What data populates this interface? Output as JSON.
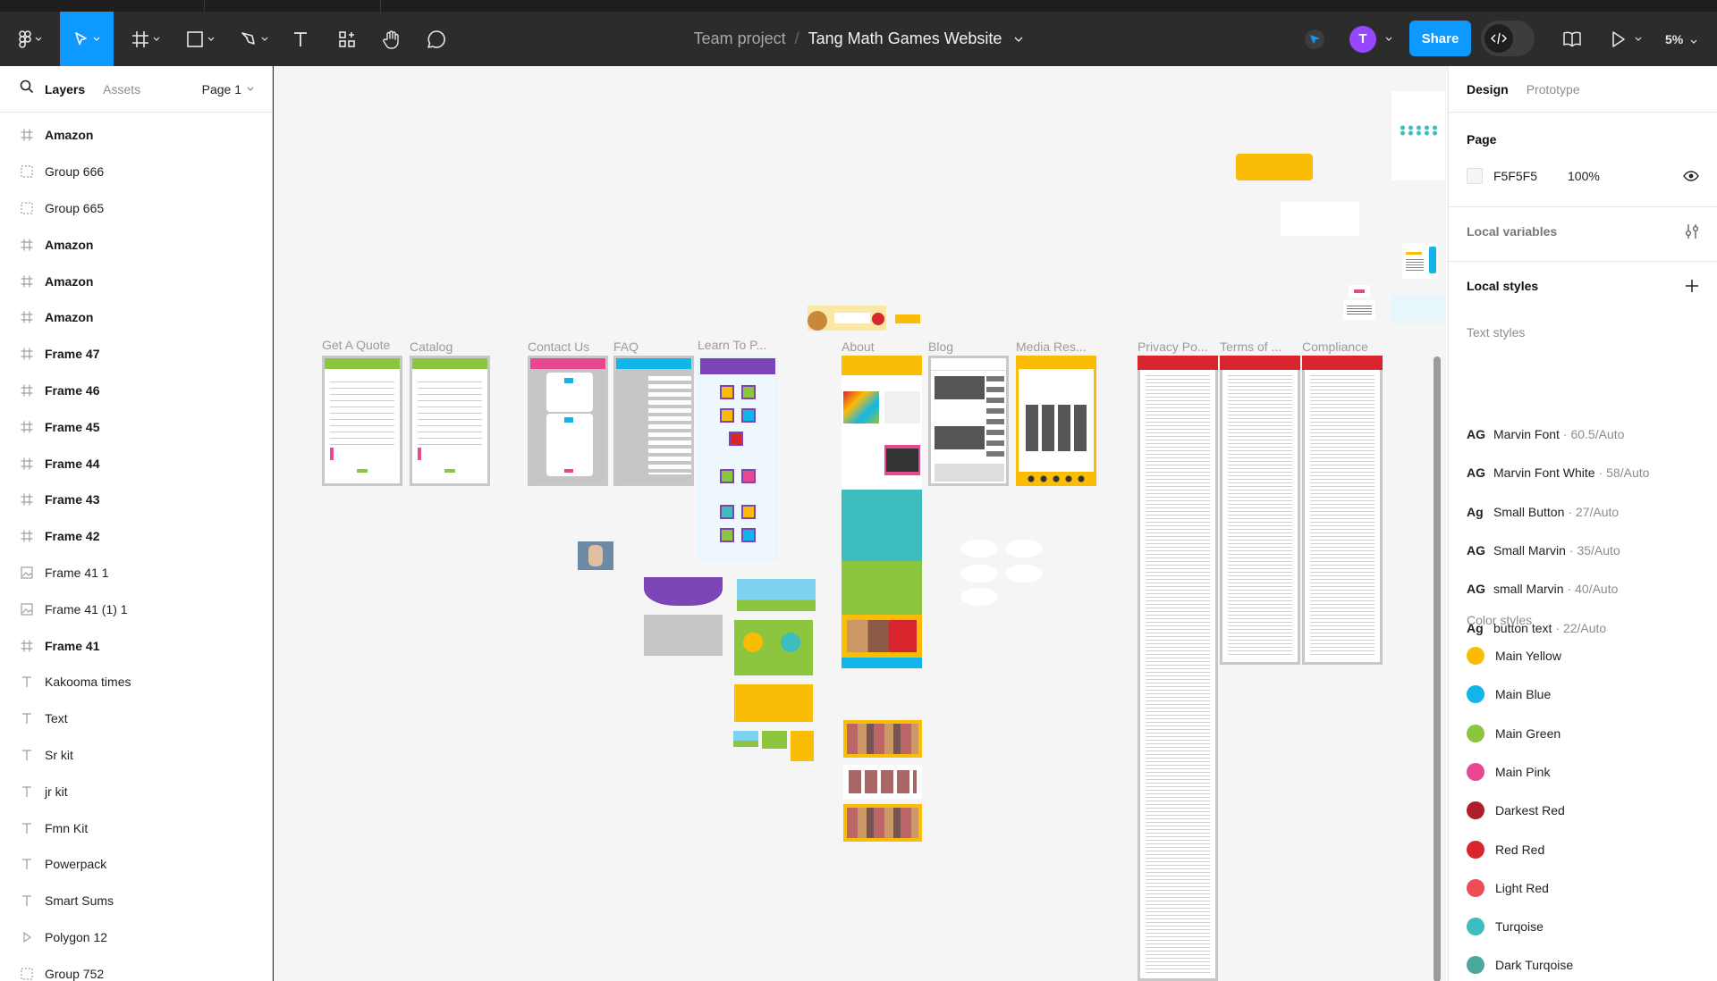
{
  "toolbar": {
    "breadcrumb_team": "Team project",
    "breadcrumb_sep": "/",
    "file_name": "Tang Math Games Website",
    "avatar_initial": "T",
    "share_label": "Share",
    "zoom": "5%",
    "colors": {
      "bar": "#2c2c2c",
      "accent": "#0d99ff",
      "avatar": "#9747ff"
    }
  },
  "left_panel": {
    "tab_layers": "Layers",
    "tab_assets": "Assets",
    "page": "Page 1",
    "layers": [
      {
        "name": "Amazon",
        "kind": "frame"
      },
      {
        "name": "Group 666",
        "kind": "group"
      },
      {
        "name": "Group 665",
        "kind": "group"
      },
      {
        "name": "Amazon",
        "kind": "frame"
      },
      {
        "name": "Amazon",
        "kind": "frame"
      },
      {
        "name": "Amazon",
        "kind": "frame"
      },
      {
        "name": "Frame 47",
        "kind": "frame"
      },
      {
        "name": "Frame 46",
        "kind": "frame"
      },
      {
        "name": "Frame 45",
        "kind": "frame"
      },
      {
        "name": "Frame 44",
        "kind": "frame"
      },
      {
        "name": "Frame 43",
        "kind": "frame"
      },
      {
        "name": "Frame 42",
        "kind": "frame"
      },
      {
        "name": "Frame 41 1",
        "kind": "image"
      },
      {
        "name": "Frame 41 (1) 1",
        "kind": "image"
      },
      {
        "name": "Frame 41",
        "kind": "frame"
      },
      {
        "name": "Kakooma times",
        "kind": "text"
      },
      {
        "name": "Text",
        "kind": "text"
      },
      {
        "name": "Sr kit",
        "kind": "text"
      },
      {
        "name": "jr kit",
        "kind": "text"
      },
      {
        "name": "Fmn Kit",
        "kind": "text"
      },
      {
        "name": "Powerpack",
        "kind": "text"
      },
      {
        "name": "Smart Sums",
        "kind": "text"
      },
      {
        "name": "Polygon 12",
        "kind": "polygon"
      },
      {
        "name": "Group 752",
        "kind": "group"
      }
    ]
  },
  "canvas": {
    "background": "#f5f5f5",
    "frame_labels": {
      "quote": "Get A Quote",
      "catalog": "Catalog",
      "contact": "Contact Us",
      "faq": "FAQ",
      "learn": "Learn To P...",
      "about": "About",
      "blog": "Blog",
      "media": "Media Res...",
      "privacy": "Privacy Po...",
      "terms": "Terms of ...",
      "compliance": "Compliance"
    }
  },
  "right_panel": {
    "tab_design": "Design",
    "tab_prototype": "Prototype",
    "page_title": "Page",
    "page_color": "F5F5F5",
    "page_opacity": "100%",
    "local_variables": "Local variables",
    "local_styles": "Local styles",
    "text_styles_title": "Text styles",
    "text_styles": [
      {
        "ag": "AG",
        "name": "Marvin Font",
        "meta": "· 60.5/Auto"
      },
      {
        "ag": "AG",
        "name": "Marvin Font White",
        "meta": "· 58/Auto"
      },
      {
        "ag": "Ag",
        "name": "Small Button",
        "meta": "· 27/Auto"
      },
      {
        "ag": "AG",
        "name": "Small Marvin",
        "meta": "· 35/Auto"
      },
      {
        "ag": "AG",
        "name": "small Marvin",
        "meta": "· 40/Auto"
      },
      {
        "ag": "Ag",
        "name": "button text",
        "meta": "· 22/Auto"
      }
    ],
    "color_styles_title": "Color styles",
    "color_styles": [
      {
        "name": "Main Yellow",
        "color": "#fbbc05"
      },
      {
        "name": "Main Blue",
        "color": "#12b5ea"
      },
      {
        "name": "Main Green",
        "color": "#8cc63f"
      },
      {
        "name": "Main Pink",
        "color": "#e8488f"
      },
      {
        "name": "Darkest Red",
        "color": "#b01e2b"
      },
      {
        "name": "Red Red",
        "color": "#d9262e"
      },
      {
        "name": "Light Red",
        "color": "#ee4c56"
      },
      {
        "name": "Turqoise",
        "color": "#3dbdbd"
      },
      {
        "name": "Dark Turqoise",
        "color": "#4da79a"
      }
    ]
  }
}
